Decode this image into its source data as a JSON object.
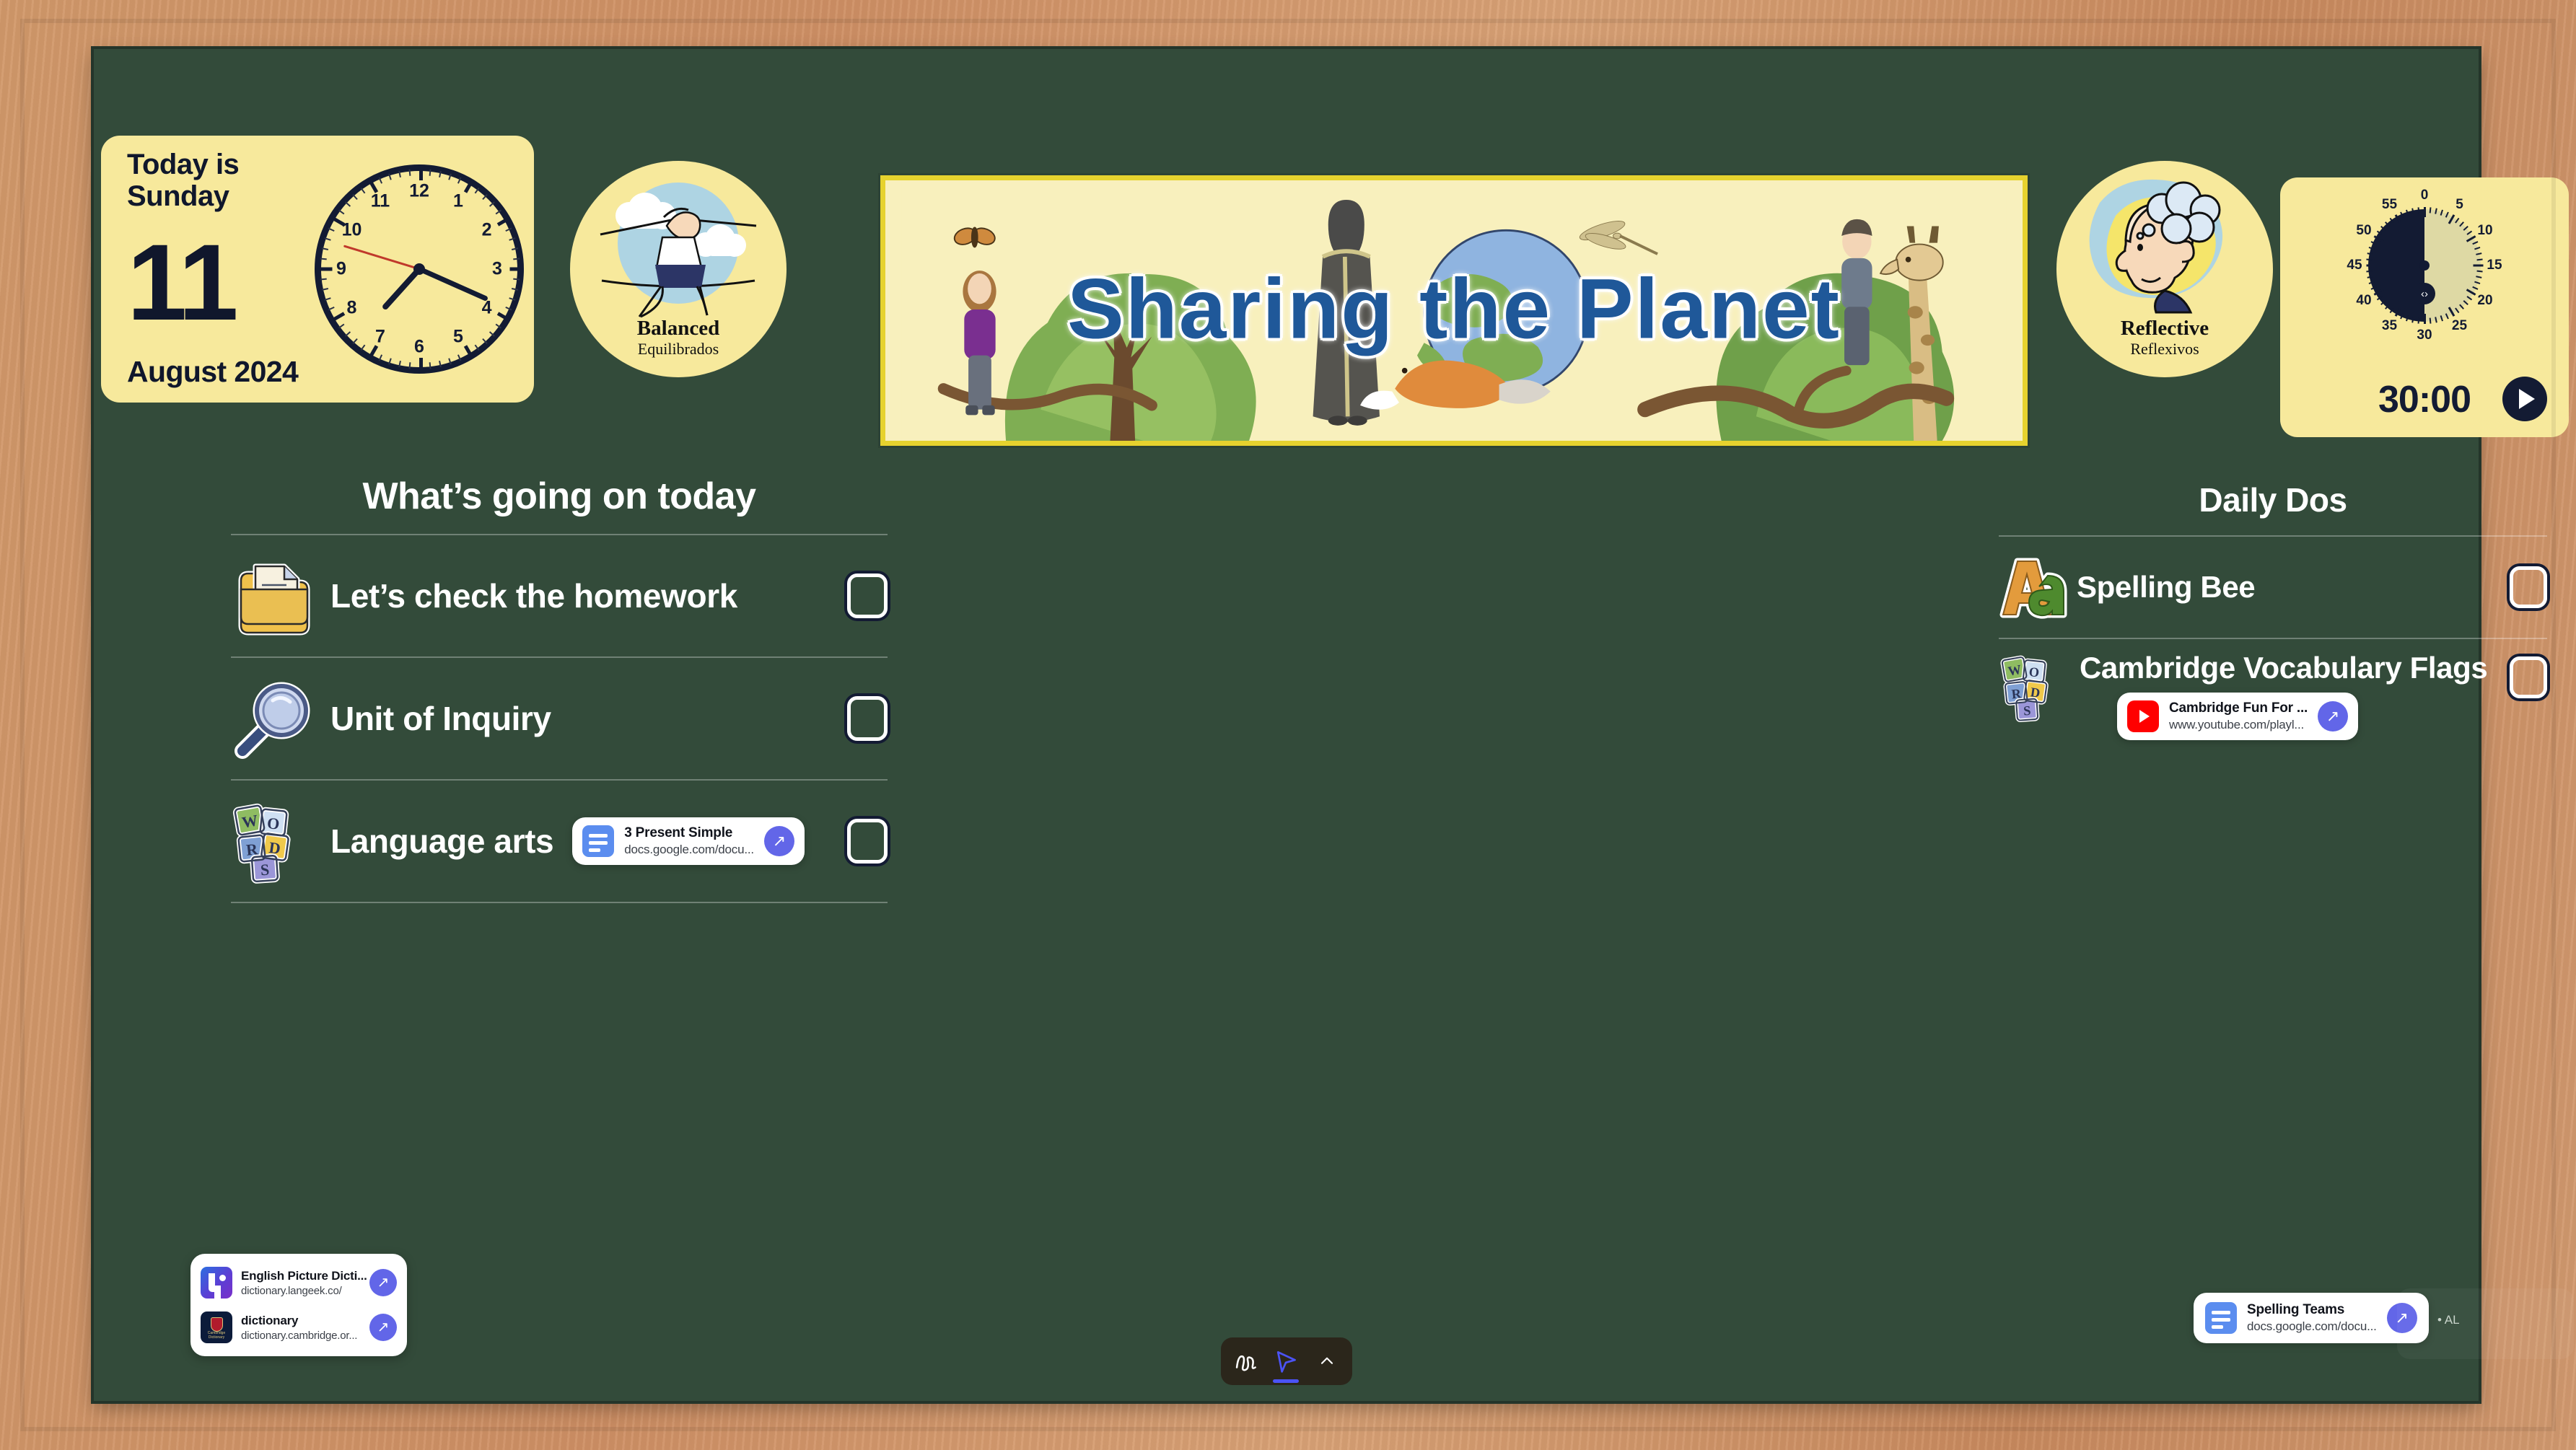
{
  "theme": {
    "frame_wood": "#d2996b",
    "chalkboard": "#334b3a",
    "card_yellow": "#f7e99c",
    "banner_yellow": "#f8f0bd",
    "banner_border": "#e6d22e",
    "banner_title_blue": "#1f5899",
    "accent_purple": "#6266e8",
    "ink_navy": "#131b33"
  },
  "date_card": {
    "today_is": "Today is\nSunday",
    "today_line1": "Today is",
    "today_line2": "Sunday",
    "day_number": "11",
    "month_year": "August 2024",
    "clock": {
      "numbers": [
        "12",
        "1",
        "2",
        "3",
        "4",
        "5",
        "6",
        "7",
        "8",
        "9",
        "10",
        "11"
      ],
      "hour_angle_deg": 222,
      "minute_angle_deg": 114,
      "second_angle_deg": 287
    }
  },
  "profiles": [
    {
      "name": "balanced",
      "title": "Balanced",
      "subtitle": "Equilibrados"
    },
    {
      "name": "reflective",
      "title": "Reflective",
      "subtitle": "Reflexivos"
    }
  ],
  "banner": {
    "title": "Sharing the  Planet"
  },
  "timer": {
    "readout": "30:00",
    "minutes_remaining": 30,
    "dial_labels": [
      "0",
      "5",
      "10",
      "15",
      "20",
      "25",
      "30",
      "35",
      "40",
      "45",
      "50",
      "55"
    ],
    "play_label": "play-button"
  },
  "today_column": {
    "title": "What’s going on today",
    "tasks": [
      {
        "icon": "folder-document-icon",
        "label": "Let’s check the homework",
        "checked": false,
        "link": null
      },
      {
        "icon": "magnifying-glass-icon",
        "label": "Unit of Inquiry",
        "checked": false,
        "link": null
      },
      {
        "icon": "word-blocks-icon",
        "label": "Language arts",
        "checked": false,
        "link": {
          "kind": "gdoc",
          "title": "3 Present Simple",
          "url": "docs.google.com/docu...",
          "open_label": "↗"
        }
      }
    ]
  },
  "daily_column": {
    "title": "Daily Dos",
    "tasks": [
      {
        "icon": "aa-letters-icon",
        "label": "Spelling Bee",
        "checked": false,
        "link": null
      },
      {
        "icon": "word-blocks-icon",
        "label": "Cambridge Vocabulary Flags",
        "checked": false,
        "link": {
          "kind": "youtube",
          "title": "Cambridge Fun For ...",
          "url": "www.youtube.com/playl...",
          "open_label": "↗"
        }
      }
    ]
  },
  "dictionary_chips": [
    {
      "icon": "langeek-icon",
      "title": "English Picture Dicti...",
      "url": "dictionary.langeek.co/",
      "open_label": "↗"
    },
    {
      "icon": "cambridge-dictionary-icon",
      "title": "dictionary",
      "url": "dictionary.cambridge.or...",
      "open_label": "↗"
    }
  ],
  "spelling_teams_chip": {
    "icon": "gdoc-icon",
    "title": "Spelling Teams",
    "url": "docs.google.com/docu...",
    "open_label": "↗"
  },
  "note": {
    "text": "• AL"
  },
  "toolbar": {
    "tools": [
      {
        "name": "scribble-pen-icon",
        "active": false
      },
      {
        "name": "cursor-pointer-icon",
        "active": true
      },
      {
        "name": "chevron-up-icon",
        "active": false
      }
    ]
  }
}
